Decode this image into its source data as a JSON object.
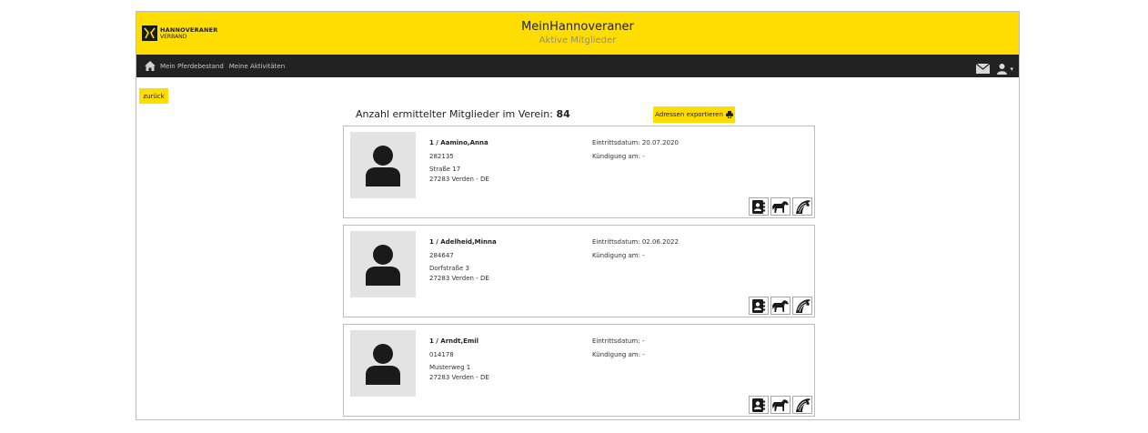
{
  "brand": {
    "line1": "HANNOVERANER",
    "line2": "VERBAND"
  },
  "header": {
    "title": "MeinHannoveraner",
    "subtitle": "Aktive Mitglieder"
  },
  "nav": {
    "items": [
      "Mein Pferdebestand",
      "Meine Aktivitäten"
    ]
  },
  "back_label": "zurück",
  "count": {
    "label": "Anzahl ermittelter Mitglieder im Verein:",
    "value": "84"
  },
  "export_label": "Adressen exportieren",
  "members": [
    {
      "name": "1 / Aamino,Anna",
      "number": "282135",
      "street": "Straße 17",
      "city": "27283 Verden - DE",
      "entry": "Eintrittsdatum: 20.07.2020",
      "quit": "Kündigung am: -"
    },
    {
      "name": "1 / Adelheid,Minna",
      "number": "284647",
      "street": "Dorfstraße 3",
      "city": "27283 Verden - DE",
      "entry": "Eintrittsdatum: 02.06.2022",
      "quit": "Kündigung am: -"
    },
    {
      "name": "1 / Arndt,Emil",
      "number": "014178",
      "street": "Musterweg 1",
      "city": "27283 Verden - DE",
      "entry": "Eintrittsdatum: -",
      "quit": "Kündigung am: -"
    }
  ],
  "icons": {
    "home": "home-icon",
    "mail": "mail-icon",
    "user": "user-icon",
    "contact": "contact-book-icon",
    "horse": "horse-icon",
    "mane": "horse-head-icon"
  },
  "colors": {
    "brand_yellow": "#ffdd00",
    "nav_dark": "#222222"
  }
}
